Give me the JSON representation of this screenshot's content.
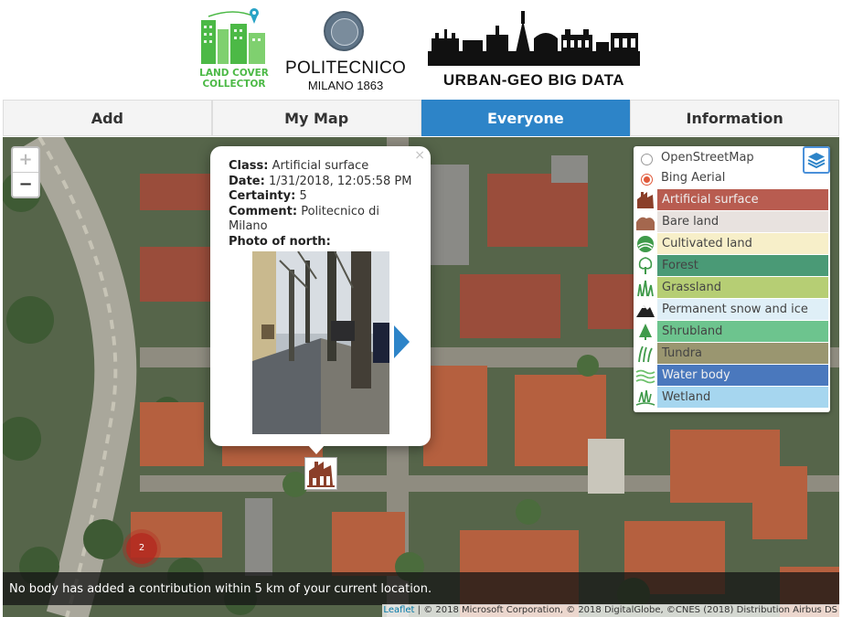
{
  "header": {
    "logos": {
      "land_cover_collector": {
        "line1": "LAND COVER",
        "line2": "COLLECTOR"
      },
      "politecnico": {
        "name": "POLITECNICO",
        "sub": "MILANO 1863"
      },
      "urban_geo": {
        "name": "URBAN-GEO BIG DATA"
      }
    }
  },
  "nav": {
    "tabs": [
      {
        "label": "Add",
        "active": false
      },
      {
        "label": "My Map",
        "active": false
      },
      {
        "label": "Everyone",
        "active": true
      },
      {
        "label": "Information",
        "active": false
      }
    ]
  },
  "map": {
    "zoom": {
      "in": "+",
      "out": "−"
    },
    "popup": {
      "close": "×",
      "class_label": "Class:",
      "class_value": "Artificial surface",
      "date_label": "Date:",
      "date_value": "1/31/2018, 12:05:58 PM",
      "certainty_label": "Certainty:",
      "certainty_value": "5",
      "comment_label": "Comment:",
      "comment_value": "Politecnico di Milano",
      "photo_label": "Photo of north:"
    },
    "cluster_count": "2",
    "layer_control": {
      "base_layers": [
        {
          "label": "OpenStreetMap",
          "checked": false
        },
        {
          "label": "Bing Aerial",
          "checked": true
        }
      ],
      "overlays": [
        {
          "label": "Artificial surface",
          "icon": "artificial-surface-icon",
          "color": "#b85c50"
        },
        {
          "label": "Bare land",
          "icon": "bare-land-icon",
          "color": "#e8e2df"
        },
        {
          "label": "Cultivated land",
          "icon": "cultivated-land-icon",
          "color": "#f7efc9"
        },
        {
          "label": "Forest",
          "icon": "forest-icon",
          "color": "#4a9a76"
        },
        {
          "label": "Grassland",
          "icon": "grassland-icon",
          "color": "#b6ce74"
        },
        {
          "label": "Permanent snow and ice",
          "icon": "snow-ice-icon",
          "color": "#dfeff7"
        },
        {
          "label": "Shrubland",
          "icon": "shrubland-icon",
          "color": "#6dc48e"
        },
        {
          "label": "Tundra",
          "icon": "tundra-icon",
          "color": "#9a9670"
        },
        {
          "label": "Water body",
          "icon": "water-body-icon",
          "color": "#4a78bd"
        },
        {
          "label": "Wetland",
          "icon": "wetland-icon",
          "color": "#a6d6ef"
        }
      ]
    },
    "notice": "No body has added a contribution within 5 km of your current location.",
    "attribution": {
      "leaflet": "Leaflet",
      "text": "| © 2018 Microsoft Corporation, © 2018 DigitalGlobe, ©CNES (2018) Distribution Airbus DS"
    }
  }
}
